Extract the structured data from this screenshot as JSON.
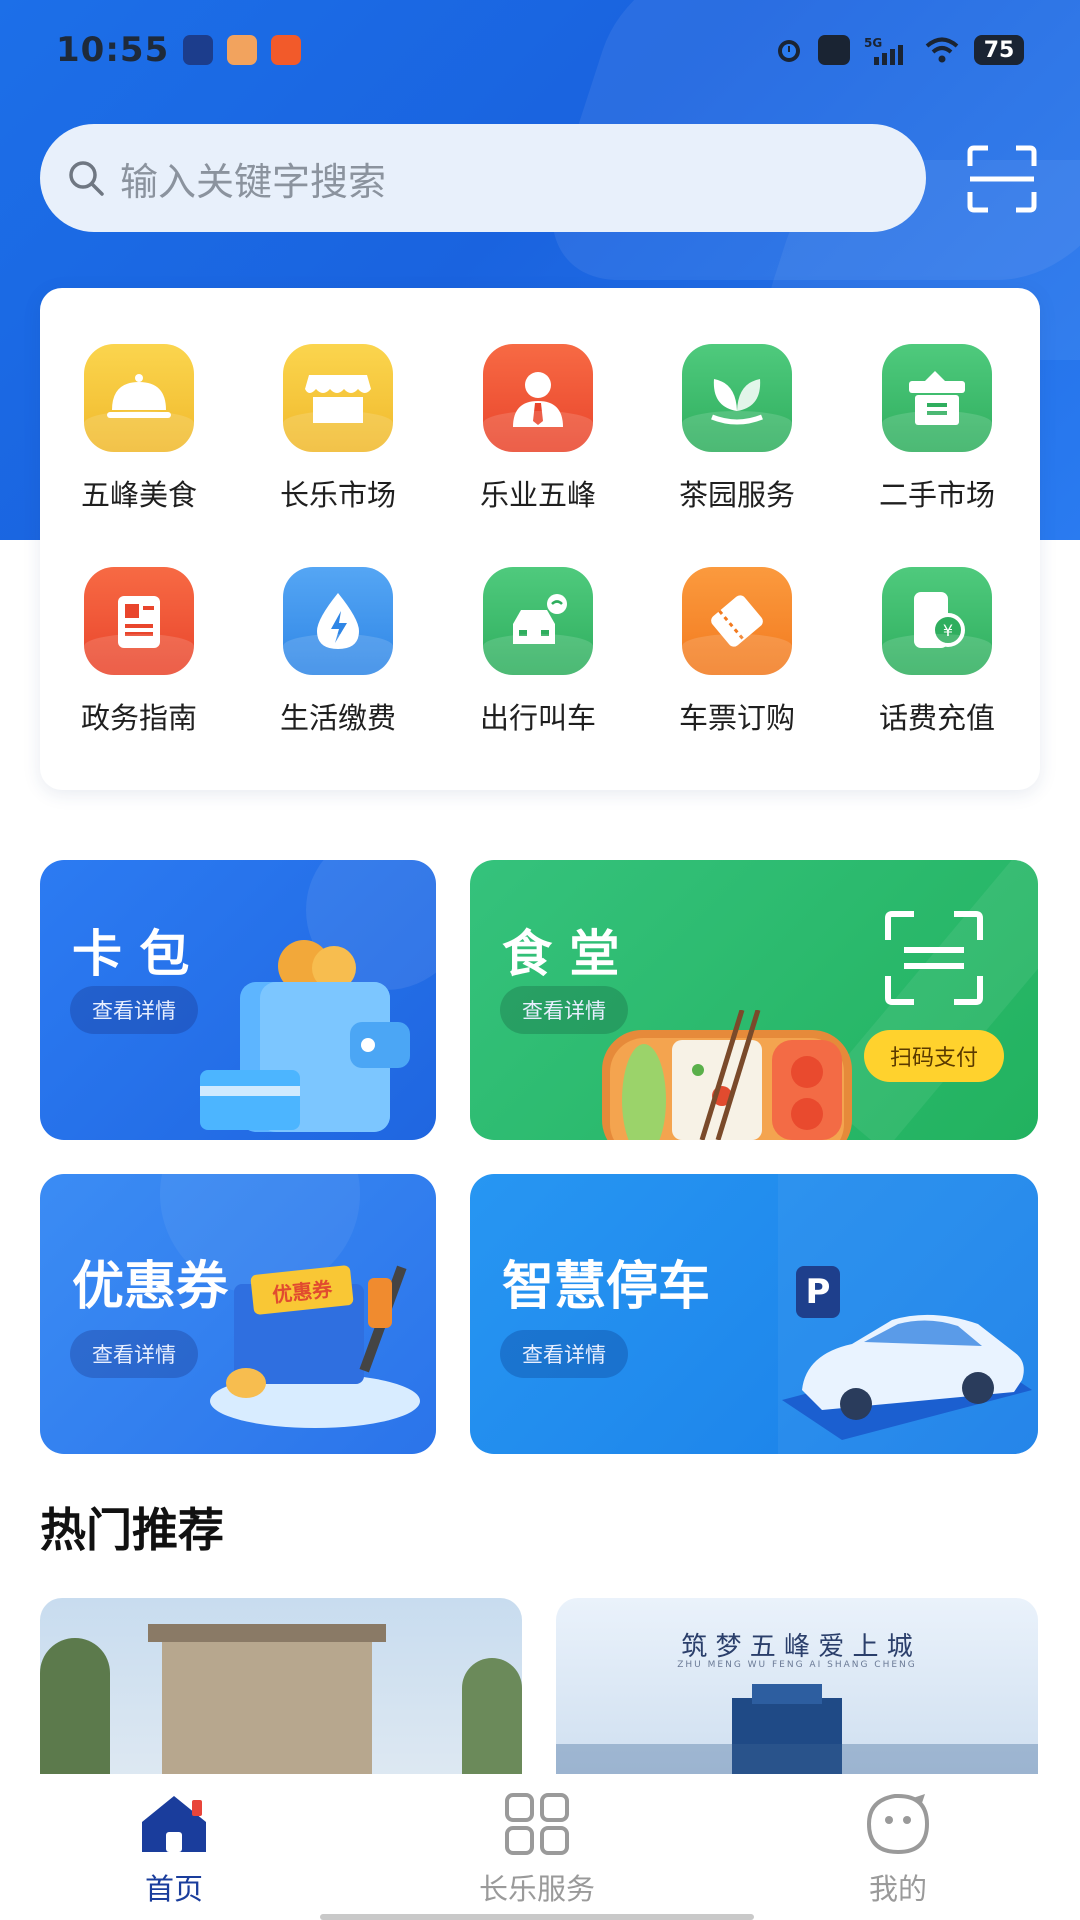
{
  "status_bar": {
    "time": "10:55",
    "battery": "75",
    "network": "5G"
  },
  "search": {
    "placeholder": "输入关键字搜索",
    "scan_icon": "scan-icon"
  },
  "services": [
    {
      "label": "五峰美食",
      "icon": "food-cloche-icon",
      "color": "#f5c53c"
    },
    {
      "label": "长乐市场",
      "icon": "store-icon",
      "color": "#f5c53c"
    },
    {
      "label": "乐业五峰",
      "icon": "employment-person-icon",
      "color": "#f0553a"
    },
    {
      "label": "茶园服务",
      "icon": "tea-leaf-icon",
      "color": "#3dbb6d"
    },
    {
      "label": "二手市场",
      "icon": "secondhand-box-icon",
      "color": "#3dbb6d"
    },
    {
      "label": "政务指南",
      "icon": "government-doc-icon",
      "color": "#f0553a"
    },
    {
      "label": "生活缴费",
      "icon": "utility-payment-icon",
      "color": "#3d92ec"
    },
    {
      "label": "出行叫车",
      "icon": "ride-car-icon",
      "color": "#3dbb6d"
    },
    {
      "label": "车票订购",
      "icon": "ticket-icon",
      "color": "#f7842b"
    },
    {
      "label": "话费充值",
      "icon": "phone-recharge-icon",
      "color": "#3dbb6d"
    }
  ],
  "promos": {
    "card_pack": {
      "title": "卡 包",
      "detail": "查看详情"
    },
    "canteen": {
      "title": "食 堂",
      "detail": "查看详情",
      "pay": "扫码支付"
    },
    "coupon": {
      "title": "优惠券",
      "detail": "查看详情",
      "ticket_text": "优惠券"
    },
    "parking": {
      "title": "智慧停车",
      "detail": "查看详情",
      "sign": "P"
    }
  },
  "recommend": {
    "title": "热门推荐",
    "banner2_text": "筑 梦 五 峰 爱 上 城",
    "banner2_sub": "ZHU MENG WU FENG AI SHANG CHENG"
  },
  "nav": [
    {
      "label": "首页",
      "icon": "home-icon",
      "active": true
    },
    {
      "label": "长乐服务",
      "icon": "grid-icon",
      "active": false
    },
    {
      "label": "我的",
      "icon": "profile-face-icon",
      "active": false
    }
  ],
  "colors": {
    "primary": "#1c6fe8",
    "nav_active": "#1a3d9c",
    "nav_inactive": "#9a9a9a",
    "green_card": "#2fbf6b",
    "pay_yellow": "#ffd22d"
  }
}
